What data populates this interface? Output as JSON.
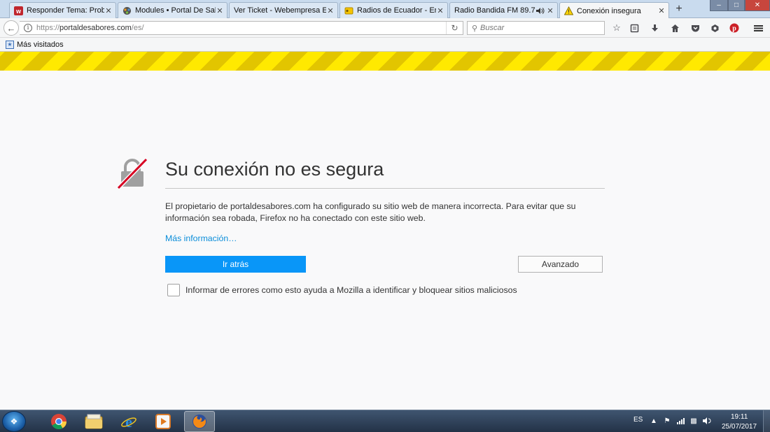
{
  "tabs": [
    {
      "label": "Responder Tema: Problem",
      "icon": "webempresa-icon",
      "close": "✕"
    },
    {
      "label": "Modules • Portal De Sabor",
      "icon": "joomla-icon",
      "close": "✕"
    },
    {
      "label": "Ver Ticket - Webempresa Euro",
      "icon": "",
      "close": "✕"
    },
    {
      "label": "Radios de Ecuador - EnLín",
      "icon": "radio-icon",
      "close": "✕"
    },
    {
      "label": "Radio Bandida FM 89.7",
      "icon": "speaker-icon",
      "close": "✕"
    },
    {
      "label": "Conexión insegura",
      "icon": "warning-icon",
      "close": "✕",
      "active": true
    }
  ],
  "newtab_label": "+",
  "window": {
    "minimize": "–",
    "maximize": "□",
    "close": "✕"
  },
  "navbar": {
    "url_prefix": "https://",
    "url_host": "portaldesabores.com",
    "url_path": "/es/",
    "search_placeholder": "Buscar"
  },
  "bookmarks": {
    "label": "Más visitados"
  },
  "error_page": {
    "title": "Su conexión no es segura",
    "description": "El propietario de portaldesabores.com ha configurado su sitio web de manera incorrecta. Para evitar que su información sea robada, Firefox no ha conectado con este sitio web.",
    "more_info": "Más información…",
    "back_button": "Ir atrás",
    "advanced_button": "Avanzado",
    "report_label": "Informar de errores como esto ayuda a Mozilla a identificar y bloquear sitios maliciosos"
  },
  "taskbar": {
    "apps": [
      "chrome-icon",
      "explorer-icon",
      "ie-icon",
      "media-player-icon",
      "firefox-icon"
    ],
    "active_app": "firefox-icon",
    "lang": "ES",
    "time": "19:11",
    "date": "25/07/2017"
  },
  "colors": {
    "primary_button": "#0996f8",
    "link": "#0a8dd9",
    "stripe_yellow": "#ffe900",
    "lock_strike": "#d70022"
  }
}
